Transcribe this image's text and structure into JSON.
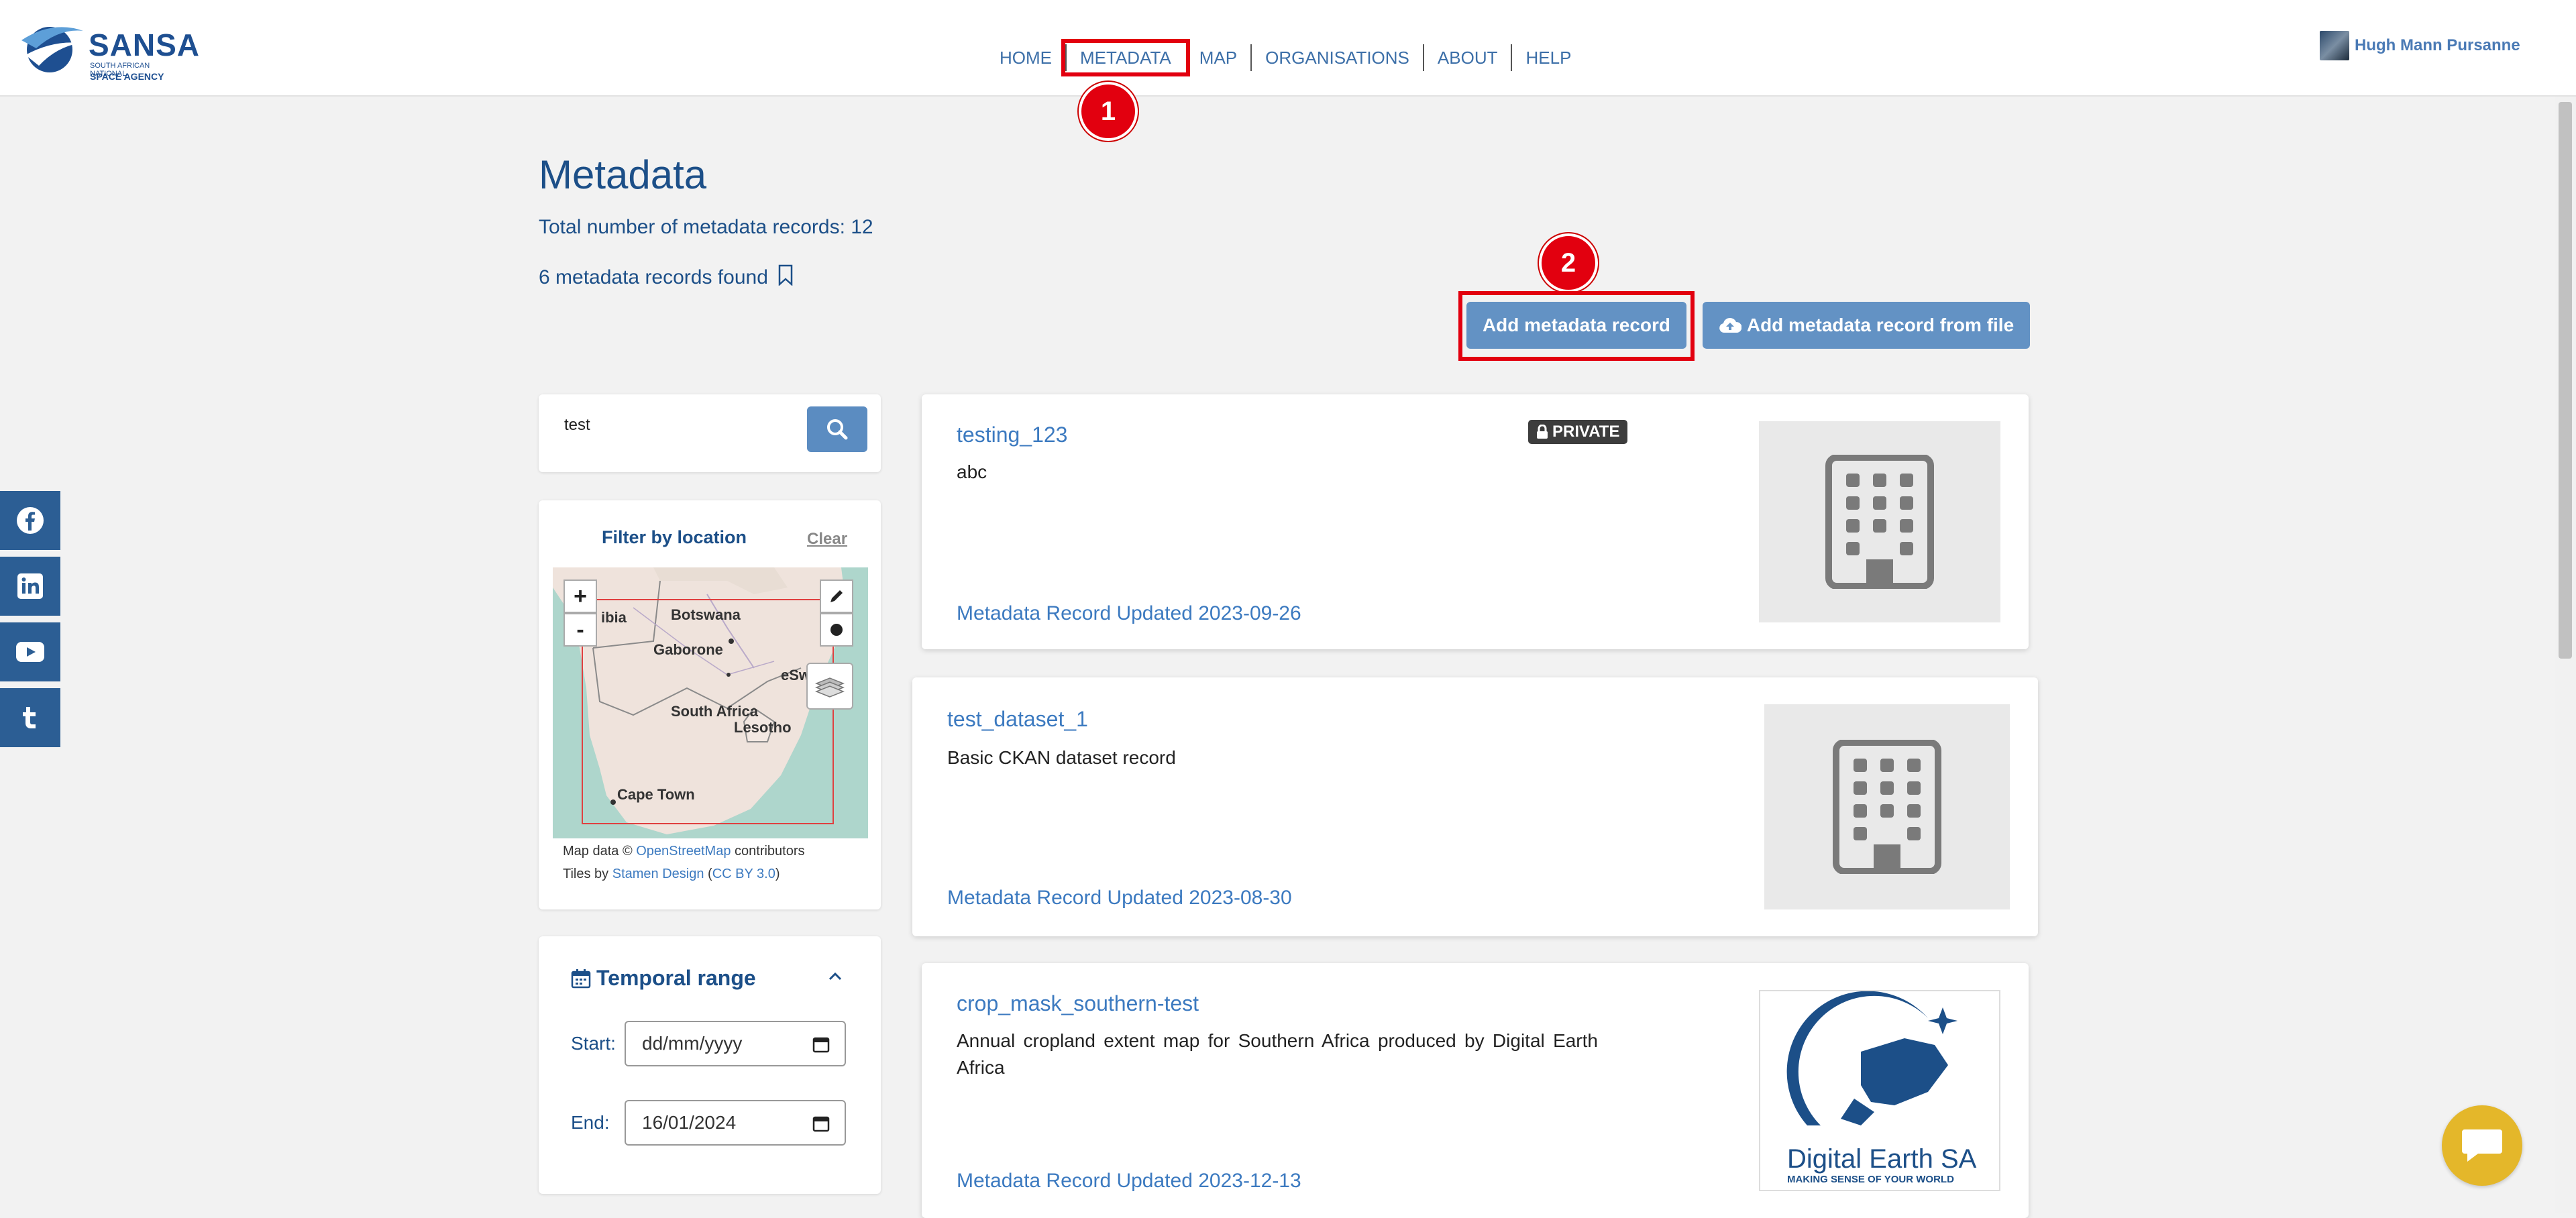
{
  "brand": {
    "name": "SANSA",
    "subtitle": "SOUTH AFRICAN NATIONAL",
    "subtitle2": "SPACE AGENCY"
  },
  "nav": {
    "items": [
      {
        "label": "HOME"
      },
      {
        "label": "METADATA"
      },
      {
        "label": "MAP"
      },
      {
        "label": "ORGANISATIONS"
      },
      {
        "label": "ABOUT"
      },
      {
        "label": "HELP"
      }
    ]
  },
  "user": {
    "name": "Hugh Mann Pursanne"
  },
  "steps": {
    "one": "1",
    "two": "2"
  },
  "page": {
    "title": "Metadata",
    "total": "Total number of metadata records: 12",
    "found": "6 metadata records found"
  },
  "actions": {
    "add_record": "Add metadata record",
    "add_from_file": "Add metadata record from file"
  },
  "search": {
    "value": "test"
  },
  "location_filter": {
    "title": "Filter by location",
    "clear": "Clear",
    "zoom_in": "+",
    "zoom_out": "-",
    "map_labels": {
      "ibia": "ibia",
      "botswana": "Botswana",
      "gaborone": "Gaborone",
      "south_africa": "South Africa",
      "lesotho": "Lesotho",
      "esw": "eSw",
      "cape_town": "Cape Town"
    },
    "attribution_1_prefix": "Map data ©",
    "attribution_1_link": "OpenStreetMap",
    "attribution_1_suffix": "contributors",
    "attribution_2_prefix": "Tiles by",
    "attribution_2_link": "Stamen Design",
    "attribution_2_open": "(",
    "attribution_2_link2": "CC BY 3.0",
    "attribution_2_close": ")"
  },
  "temporal": {
    "title": "Temporal range",
    "start_label": "Start:",
    "start_value": "dd/mm/yyyy",
    "end_label": "End:",
    "end_value": "16/01/2024"
  },
  "results": [
    {
      "title": "testing_123",
      "badge": "PRIVATE",
      "description": "abc",
      "updated": "Metadata Record Updated 2023-09-26"
    },
    {
      "title": "test_dataset_1",
      "description": "Basic CKAN dataset record",
      "updated": "Metadata Record Updated 2023-08-30"
    },
    {
      "title": "crop_mask_southern-test",
      "description": "Annual cropland extent map for Southern Africa produced by Digital Earth Africa",
      "updated": "Metadata Record Updated 2023-12-13",
      "logo_text": "Digital Earth SA",
      "logo_tagline": "MAKING SENSE OF YOUR WORLD"
    }
  ],
  "colors": {
    "primary": "#1c4f88",
    "link": "#3c7ac0",
    "button": "#6392c4",
    "highlight": "#e2000f",
    "chat": "#e4b72a"
  }
}
